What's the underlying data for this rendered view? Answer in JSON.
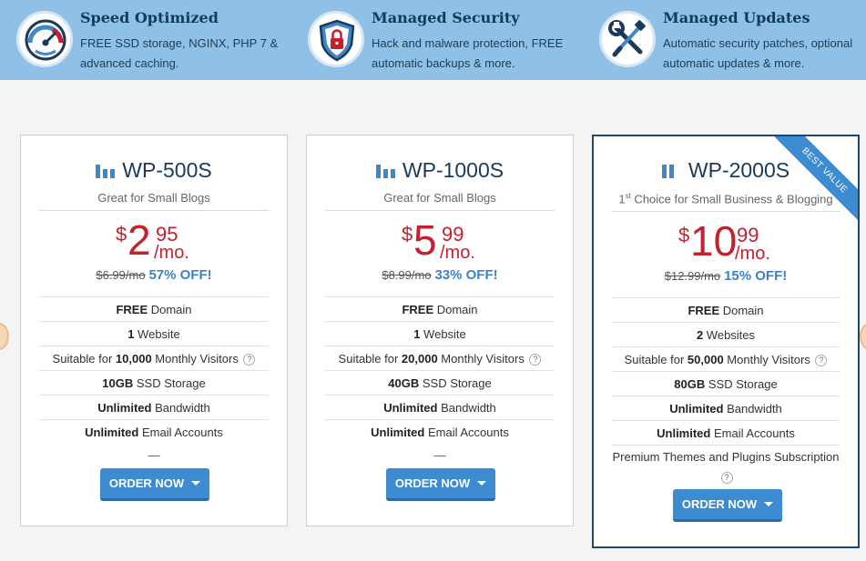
{
  "features": [
    {
      "icon": "speedometer-icon",
      "title": "Speed Optimized",
      "desc": "FREE SSD storage, NGINX, PHP 7 & advanced caching."
    },
    {
      "icon": "shield-lock-icon",
      "title": "Managed Security",
      "desc": "Hack and malware protection, FREE automatic backups & more."
    },
    {
      "icon": "wrench-screwdriver-icon",
      "title": "Managed Updates",
      "desc": "Automatic security patches, optional automatic updates & more."
    }
  ],
  "plans": [
    {
      "name": "WP-500S",
      "tagline": "Great for Small Blogs",
      "currency": "$",
      "dollars": "2",
      "cents": "95",
      "period": "/mo.",
      "old_price": "$6.99/mo",
      "discount": "57% OFF!",
      "items": [
        {
          "bold": "FREE",
          "text": " Domain"
        },
        {
          "bold": "1",
          "text": " Website"
        },
        {
          "pre": "Suitable for ",
          "bold": "10,000",
          "text": " Monthly Visitors",
          "help": "?"
        },
        {
          "bold": "10GB",
          "text": " SSD Storage"
        },
        {
          "bold": "Unlimited",
          "text": " Bandwidth"
        },
        {
          "bold": "Unlimited",
          "text": " Email Accounts"
        }
      ],
      "extra": "—",
      "order_label": "ORDER NOW"
    },
    {
      "name": "WP-1000S",
      "tagline": "Great for Small Blogs",
      "currency": "$",
      "dollars": "5",
      "cents": "99",
      "period": "/mo.",
      "old_price": "$8.99/mo",
      "discount": "33% OFF!",
      "items": [
        {
          "bold": "FREE",
          "text": " Domain"
        },
        {
          "bold": "1",
          "text": " Website"
        },
        {
          "pre": "Suitable for ",
          "bold": "20,000",
          "text": " Monthly Visitors",
          "help": "?"
        },
        {
          "bold": "40GB",
          "text": " SSD Storage"
        },
        {
          "bold": "Unlimited",
          "text": " Bandwidth"
        },
        {
          "bold": "Unlimited",
          "text": " Email Accounts"
        }
      ],
      "extra": "—",
      "order_label": "ORDER NOW"
    },
    {
      "name": "WP-2000S",
      "tagline_sup": "st",
      "tagline_pre": "1",
      "tagline": " Choice for Small Business & Blogging",
      "currency": "$",
      "dollars": "10",
      "cents": "99",
      "period": "/mo.",
      "old_price": "$12.99/mo",
      "discount": "15% OFF!",
      "ribbon": "BEST VALUE",
      "items": [
        {
          "bold": "FREE",
          "text": " Domain"
        },
        {
          "bold": "2",
          "text": " Websites"
        },
        {
          "pre": "Suitable for ",
          "bold": "50,000",
          "text": " Monthly Visitors",
          "help": "?"
        },
        {
          "bold": "80GB",
          "text": " SSD Storage"
        },
        {
          "bold": "Unlimited",
          "text": " Bandwidth"
        },
        {
          "bold": "Unlimited",
          "text": " Email Accounts"
        }
      ],
      "extra": "Premium Themes and Plugins Subscription",
      "extra_help": "?",
      "order_label": "ORDER NOW"
    }
  ],
  "colors": {
    "price": "#c7202d",
    "discount": "#3b82c6",
    "button": "#3d8bd0",
    "banner": "#8fc1e6"
  }
}
